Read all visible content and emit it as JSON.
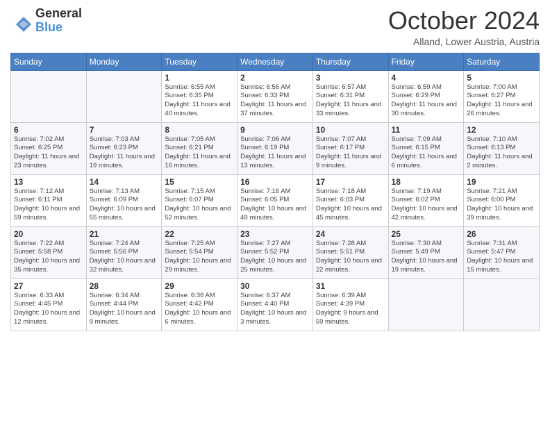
{
  "logo": {
    "general": "General",
    "blue": "Blue"
  },
  "title": "October 2024",
  "location": "Alland, Lower Austria, Austria",
  "days_of_week": [
    "Sunday",
    "Monday",
    "Tuesday",
    "Wednesday",
    "Thursday",
    "Friday",
    "Saturday"
  ],
  "weeks": [
    [
      {
        "day": "",
        "info": ""
      },
      {
        "day": "",
        "info": ""
      },
      {
        "day": "1",
        "info": "Sunrise: 6:55 AM\nSunset: 6:35 PM\nDaylight: 11 hours and 40 minutes."
      },
      {
        "day": "2",
        "info": "Sunrise: 6:56 AM\nSunset: 6:33 PM\nDaylight: 11 hours and 37 minutes."
      },
      {
        "day": "3",
        "info": "Sunrise: 6:57 AM\nSunset: 6:31 PM\nDaylight: 11 hours and 33 minutes."
      },
      {
        "day": "4",
        "info": "Sunrise: 6:59 AM\nSunset: 6:29 PM\nDaylight: 11 hours and 30 minutes."
      },
      {
        "day": "5",
        "info": "Sunrise: 7:00 AM\nSunset: 6:27 PM\nDaylight: 11 hours and 26 minutes."
      }
    ],
    [
      {
        "day": "6",
        "info": "Sunrise: 7:02 AM\nSunset: 6:25 PM\nDaylight: 11 hours and 23 minutes."
      },
      {
        "day": "7",
        "info": "Sunrise: 7:03 AM\nSunset: 6:23 PM\nDaylight: 11 hours and 19 minutes."
      },
      {
        "day": "8",
        "info": "Sunrise: 7:05 AM\nSunset: 6:21 PM\nDaylight: 11 hours and 16 minutes."
      },
      {
        "day": "9",
        "info": "Sunrise: 7:06 AM\nSunset: 6:19 PM\nDaylight: 11 hours and 13 minutes."
      },
      {
        "day": "10",
        "info": "Sunrise: 7:07 AM\nSunset: 6:17 PM\nDaylight: 11 hours and 9 minutes."
      },
      {
        "day": "11",
        "info": "Sunrise: 7:09 AM\nSunset: 6:15 PM\nDaylight: 11 hours and 6 minutes."
      },
      {
        "day": "12",
        "info": "Sunrise: 7:10 AM\nSunset: 6:13 PM\nDaylight: 11 hours and 2 minutes."
      }
    ],
    [
      {
        "day": "13",
        "info": "Sunrise: 7:12 AM\nSunset: 6:11 PM\nDaylight: 10 hours and 59 minutes."
      },
      {
        "day": "14",
        "info": "Sunrise: 7:13 AM\nSunset: 6:09 PM\nDaylight: 10 hours and 55 minutes."
      },
      {
        "day": "15",
        "info": "Sunrise: 7:15 AM\nSunset: 6:07 PM\nDaylight: 10 hours and 52 minutes."
      },
      {
        "day": "16",
        "info": "Sunrise: 7:16 AM\nSunset: 6:05 PM\nDaylight: 10 hours and 49 minutes."
      },
      {
        "day": "17",
        "info": "Sunrise: 7:18 AM\nSunset: 6:03 PM\nDaylight: 10 hours and 45 minutes."
      },
      {
        "day": "18",
        "info": "Sunrise: 7:19 AM\nSunset: 6:02 PM\nDaylight: 10 hours and 42 minutes."
      },
      {
        "day": "19",
        "info": "Sunrise: 7:21 AM\nSunset: 6:00 PM\nDaylight: 10 hours and 39 minutes."
      }
    ],
    [
      {
        "day": "20",
        "info": "Sunrise: 7:22 AM\nSunset: 5:58 PM\nDaylight: 10 hours and 35 minutes."
      },
      {
        "day": "21",
        "info": "Sunrise: 7:24 AM\nSunset: 5:56 PM\nDaylight: 10 hours and 32 minutes."
      },
      {
        "day": "22",
        "info": "Sunrise: 7:25 AM\nSunset: 5:54 PM\nDaylight: 10 hours and 29 minutes."
      },
      {
        "day": "23",
        "info": "Sunrise: 7:27 AM\nSunset: 5:52 PM\nDaylight: 10 hours and 25 minutes."
      },
      {
        "day": "24",
        "info": "Sunrise: 7:28 AM\nSunset: 5:51 PM\nDaylight: 10 hours and 22 minutes."
      },
      {
        "day": "25",
        "info": "Sunrise: 7:30 AM\nSunset: 5:49 PM\nDaylight: 10 hours and 19 minutes."
      },
      {
        "day": "26",
        "info": "Sunrise: 7:31 AM\nSunset: 5:47 PM\nDaylight: 10 hours and 15 minutes."
      }
    ],
    [
      {
        "day": "27",
        "info": "Sunrise: 6:33 AM\nSunset: 4:45 PM\nDaylight: 10 hours and 12 minutes."
      },
      {
        "day": "28",
        "info": "Sunrise: 6:34 AM\nSunset: 4:44 PM\nDaylight: 10 hours and 9 minutes."
      },
      {
        "day": "29",
        "info": "Sunrise: 6:36 AM\nSunset: 4:42 PM\nDaylight: 10 hours and 6 minutes."
      },
      {
        "day": "30",
        "info": "Sunrise: 6:37 AM\nSunset: 4:40 PM\nDaylight: 10 hours and 3 minutes."
      },
      {
        "day": "31",
        "info": "Sunrise: 6:39 AM\nSunset: 4:39 PM\nDaylight: 9 hours and 59 minutes."
      },
      {
        "day": "",
        "info": ""
      },
      {
        "day": "",
        "info": ""
      }
    ]
  ]
}
